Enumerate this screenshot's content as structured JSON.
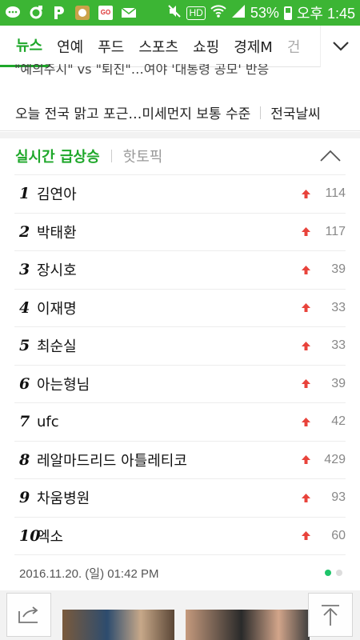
{
  "status_bar": {
    "battery_percent": "53%",
    "time": "오후 1:45",
    "network_badge": "HD",
    "icons": [
      "chat-icon",
      "sync-icon",
      "p-app-icon",
      "sun-app-icon",
      "go-app-icon",
      "mail-icon",
      "mute-icon",
      "hd-icon",
      "wifi-icon",
      "signal-icon",
      "battery-icon"
    ],
    "go_label": "GO"
  },
  "tabs": [
    {
      "label": "뉴스",
      "active": true
    },
    {
      "label": "연예"
    },
    {
      "label": "푸드"
    },
    {
      "label": "스포츠"
    },
    {
      "label": "쇼핑"
    },
    {
      "label": "경제M"
    },
    {
      "label": "건"
    }
  ],
  "news_snippet": "\"예의주시\" vs \"퇴진\"…여야 '대통령 공모' 반응",
  "weather": {
    "text": "오늘 전국 맑고 포근…미세먼지 보통 수준",
    "link": "전국날씨"
  },
  "ranking": {
    "active_tab": "실시간 급상승",
    "other_tab": "핫토픽",
    "items": [
      {
        "rank": "1",
        "keyword": "김연아",
        "count": "114"
      },
      {
        "rank": "2",
        "keyword": "박태환",
        "count": "117"
      },
      {
        "rank": "3",
        "keyword": "장시호",
        "count": "39"
      },
      {
        "rank": "4",
        "keyword": "이재명",
        "count": "33"
      },
      {
        "rank": "5",
        "keyword": "최순실",
        "count": "33"
      },
      {
        "rank": "6",
        "keyword": "아는형님",
        "count": "39"
      },
      {
        "rank": "7",
        "keyword": "ufc",
        "count": "42"
      },
      {
        "rank": "8",
        "keyword": "레알마드리드 아틀레티코",
        "count": "429"
      },
      {
        "rank": "9",
        "keyword": "차움병원",
        "count": "93"
      },
      {
        "rank": "10",
        "keyword": "엑소",
        "count": "60"
      }
    ],
    "date": "2016.11.20. (일) 01:42 PM",
    "page_dots": {
      "total": 2,
      "active": 1
    }
  },
  "colors": {
    "brand_green": "#3cb534",
    "active_green": "#1ea72a",
    "rise_red": "#e8433b"
  }
}
